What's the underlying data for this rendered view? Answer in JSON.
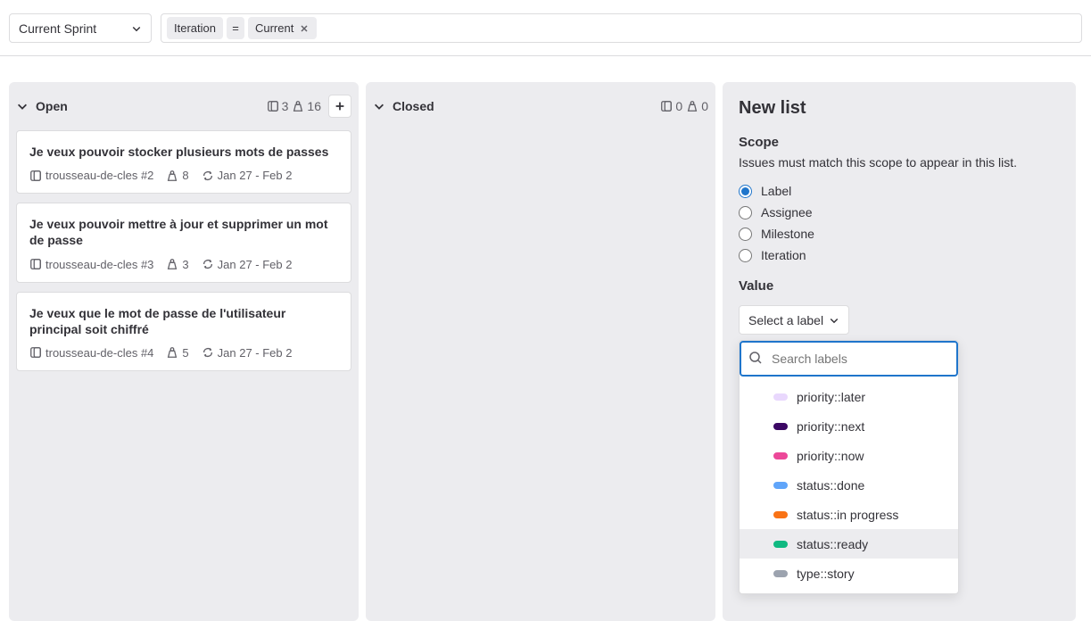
{
  "filterBar": {
    "sprintLabel": "Current Sprint",
    "chipField": "Iteration",
    "chipOp": "=",
    "chipValue": "Current"
  },
  "columns": [
    {
      "title": "Open",
      "issueCount": "3",
      "weightCount": "16",
      "showAdd": true,
      "cards": [
        {
          "title": "Je veux pouvoir stocker plusieurs mots de passes",
          "project": "trousseau-de-cles #2",
          "weight": "8",
          "dates": "Jan 27 - Feb 2"
        },
        {
          "title": "Je veux pouvoir mettre à jour et supprimer un mot de passe",
          "project": "trousseau-de-cles #3",
          "weight": "3",
          "dates": "Jan 27 - Feb 2"
        },
        {
          "title": "Je veux que le mot de passe de l'utilisateur principal soit chiffré",
          "project": "trousseau-de-cles #4",
          "weight": "5",
          "dates": "Jan 27 - Feb 2"
        }
      ]
    },
    {
      "title": "Closed",
      "issueCount": "0",
      "weightCount": "0",
      "showAdd": false,
      "cards": []
    }
  ],
  "panel": {
    "title": "New list",
    "scopeLabel": "Scope",
    "scopeDesc": "Issues must match this scope to appear in this list.",
    "radios": [
      "Label",
      "Assignee",
      "Milestone",
      "Iteration"
    ],
    "selectedRadio": 0,
    "valueLabel": "Value",
    "selectLabelText": "Select a label",
    "searchPlaceholder": "Search labels",
    "options": [
      {
        "text": "priority::later",
        "color": "#e9d8fd"
      },
      {
        "text": "priority::next",
        "color": "#3b0764"
      },
      {
        "text": "priority::now",
        "color": "#ec4899"
      },
      {
        "text": "status::done",
        "color": "#60a5fa"
      },
      {
        "text": "status::in progress",
        "color": "#f97316"
      },
      {
        "text": "status::ready",
        "color": "#10b981"
      },
      {
        "text": "type::story",
        "color": "#9ca3af"
      }
    ],
    "hoveredIndex": 5
  }
}
